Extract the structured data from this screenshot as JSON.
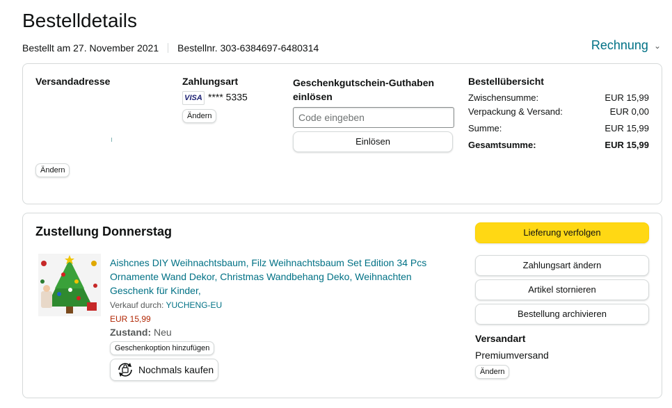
{
  "page": {
    "title": "Bestelldetails",
    "order_date": "Bestellt am 27. November 2021",
    "order_number": "Bestellnr. 303-6384697-6480314",
    "invoice_label": "Rechnung"
  },
  "summary_box": {
    "shipping": {
      "header": "Versandadresse",
      "change_label": "Ändern"
    },
    "payment": {
      "header": "Zahlungsart",
      "card_brand": "VISA",
      "card_number": "**** 5335",
      "change_label": "Ändern"
    },
    "gift": {
      "header_line1": "Geschenkgutschein-Guthaben",
      "header_line2": "einlösen",
      "input_placeholder": "Code eingeben",
      "redeem_label": "Einlösen"
    },
    "overview": {
      "header": "Bestellübersicht",
      "rows": [
        {
          "label": "Zwischensumme:",
          "value": "EUR 15,99"
        },
        {
          "label": "Verpackung & Versand:",
          "value": "EUR 0,00"
        },
        {
          "label": "Summe:",
          "value": "EUR 15,99"
        },
        {
          "label": "Gesamtsumme:",
          "value": "EUR 15,99"
        }
      ]
    }
  },
  "delivery": {
    "header": "Zustellung Donnerstag",
    "product": {
      "title_line1": "Aishcnes DIY Weihnachtsbaum, Filz Weihnachtsbaum Set Edition 34 Pcs",
      "title_line2": "Ornamente Wand Dekor, Christmas Wandbehang Deko, Weihnachten",
      "title_line3": "Geschenk für Kinder,",
      "seller_prefix": "Verkauf durch:",
      "seller_name": "YUCHENG-EU",
      "price": "EUR 15,99",
      "condition_label": "Zustand:",
      "condition_value": "Neu",
      "gift_option_label": "Geschenkoption hinzufügen",
      "buy_again_label": "Nochmals kaufen"
    },
    "actions": {
      "track": "Lieferung verfolgen",
      "change_payment": "Zahlungsart ändern",
      "cancel": "Artikel stornieren",
      "archive": "Bestellung archivieren"
    },
    "shipping_type": {
      "header": "Versandart",
      "value": "Premiumversand",
      "change_label": "Ändern"
    }
  },
  "colors": {
    "link": "#007185",
    "price": "#b12704",
    "track_button": "#ffd814",
    "border": "#d5d9d9"
  }
}
